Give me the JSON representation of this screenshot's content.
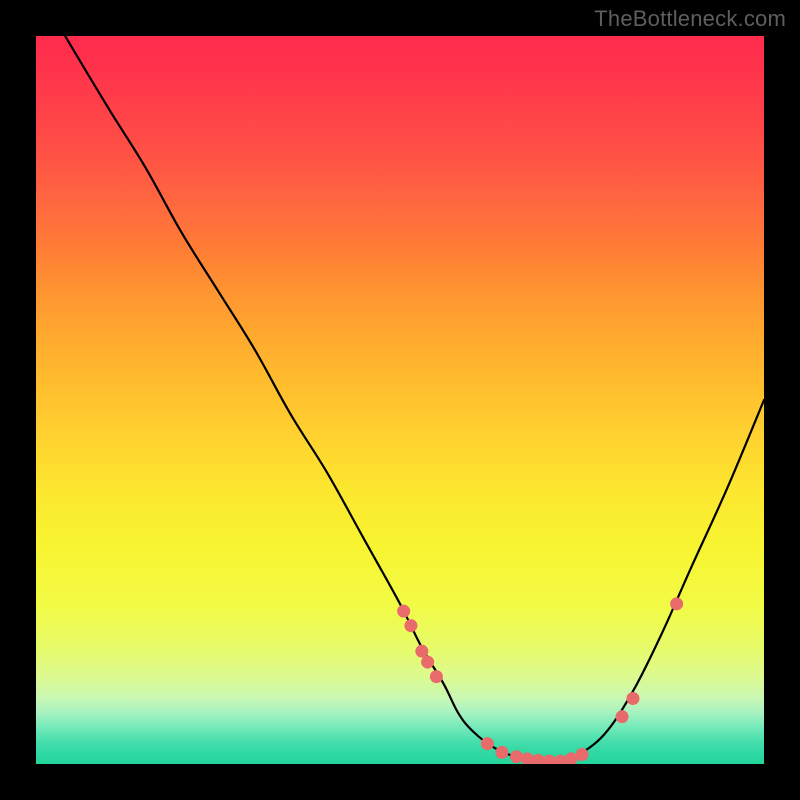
{
  "watermark": {
    "text": "TheBottleneck.com"
  },
  "plot": {
    "gradient_colors_top_to_bottom": [
      "#ff2a4d",
      "#ff5145",
      "#ff8034",
      "#ffb22e",
      "#fce62f",
      "#f2fb44",
      "#c8f8b4",
      "#45deac",
      "#25d59d"
    ]
  },
  "chart_data": {
    "type": "line",
    "title": "",
    "xlabel": "",
    "ylabel": "",
    "xlim": [
      0,
      100
    ],
    "ylim": [
      0,
      100
    ],
    "curve": {
      "name": "bottleneck-curve",
      "x": [
        4,
        10,
        15,
        20,
        25,
        30,
        35,
        40,
        45,
        50,
        53,
        56,
        58,
        60,
        63,
        66,
        70,
        72,
        74,
        78,
        82,
        86,
        90,
        95,
        100
      ],
      "y": [
        100,
        90,
        82,
        73,
        65,
        57,
        48,
        40,
        31,
        22,
        16,
        11,
        7,
        4.5,
        2.2,
        1,
        0.4,
        0.4,
        1,
        4,
        10,
        18,
        27,
        38,
        50
      ]
    },
    "series": [
      {
        "name": "markers",
        "x": [
          50.5,
          51.5,
          53.0,
          53.8,
          55.0,
          62.0,
          64.0,
          66.0,
          67.5,
          69.0,
          70.5,
          72.0,
          73.5,
          75.0,
          80.5,
          82.0,
          88.0
        ],
        "y": [
          21.0,
          19.0,
          15.5,
          14.0,
          12.0,
          2.8,
          1.6,
          1.0,
          0.7,
          0.5,
          0.4,
          0.4,
          0.7,
          1.3,
          6.5,
          9.0,
          22.0
        ]
      }
    ]
  }
}
